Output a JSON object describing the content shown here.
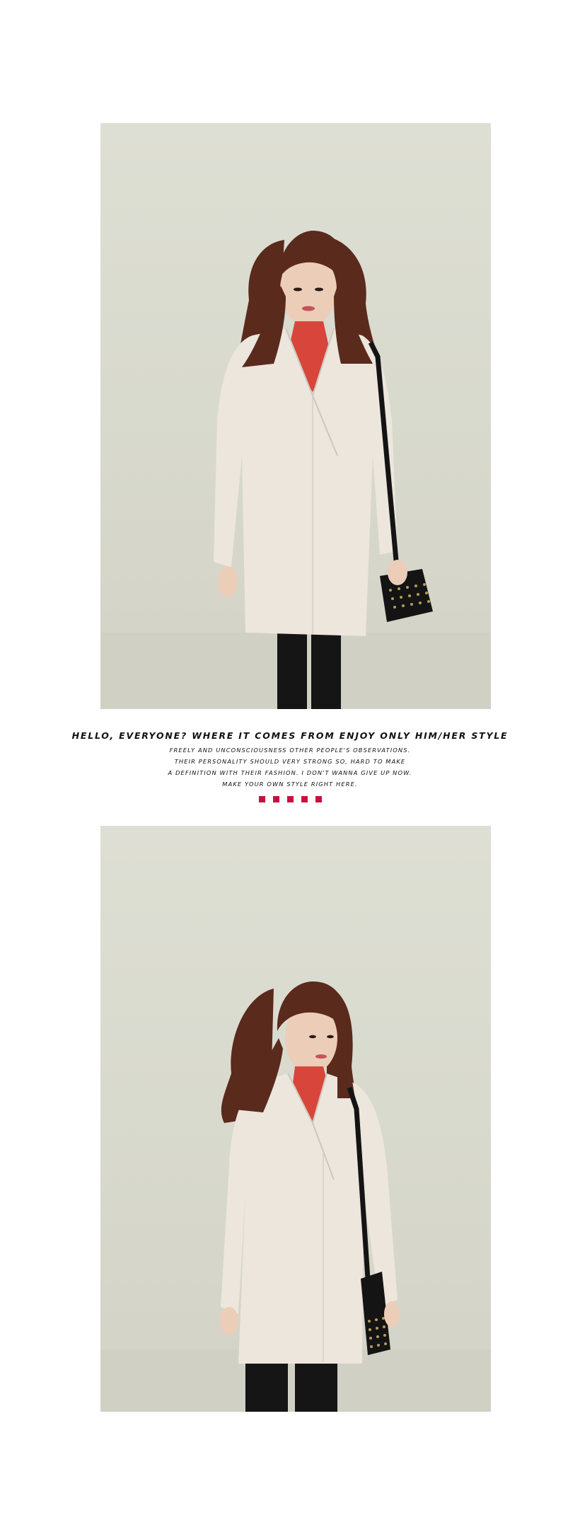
{
  "caption": {
    "headline": "HELLO, EVERYONE? WHERE IT COMES FROM ENJOY ONLY HIM/HER STYLE",
    "lines": [
      "FREELY AND UNCONSCIOUSNESS OTHER PEOPLE'S OBSERVATIONS.",
      "THEIR PERSONALITY SHOULD VERY STRONG SO, HARD TO MAKE",
      "A DEFINITION WITH THEIR FASHION. I DON'T WANNA GIVE UP NOW.",
      "MAKE YOUR OWN STYLE RIGHT HERE."
    ]
  },
  "divider": {
    "count": 5,
    "color": "#c8103e"
  },
  "colors": {
    "background": "#ffffff",
    "studio_backdrop": "#dcddd2",
    "coat": "#ece6dc",
    "hair": "#5a2a1c",
    "top": "#d8453a",
    "bag": "#141414",
    "pants": "#151515"
  }
}
